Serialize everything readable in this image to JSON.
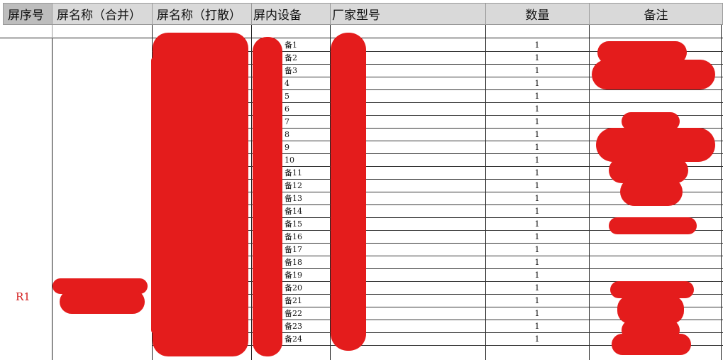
{
  "headers": {
    "screen_no": "屏序号",
    "screen_name_merged": "屏名称（合并）",
    "screen_name_split": "屏名称（打散）",
    "device_in_screen": "屏内设备",
    "vendor_model": "厂家型号",
    "quantity": "数量",
    "remarks": "备注"
  },
  "group": {
    "screen_no": "R1"
  },
  "rows": [
    {
      "device": "备1",
      "qty": "1"
    },
    {
      "device": "备2",
      "qty": "1"
    },
    {
      "device": "备3",
      "qty": "1"
    },
    {
      "device": "4",
      "qty": "1"
    },
    {
      "device": "5",
      "qty": "1"
    },
    {
      "device": "6",
      "qty": "1"
    },
    {
      "device": "7",
      "qty": "1"
    },
    {
      "device": "8",
      "qty": "1"
    },
    {
      "device": "9",
      "qty": "1"
    },
    {
      "device": "10",
      "qty": "1"
    },
    {
      "device": "备11",
      "qty": "1"
    },
    {
      "device": "备12",
      "qty": "1"
    },
    {
      "device": "备13",
      "qty": "1"
    },
    {
      "device": "备14",
      "qty": "1"
    },
    {
      "device": "备15",
      "qty": "1"
    },
    {
      "device": "备16",
      "qty": "1"
    },
    {
      "device": "备17",
      "qty": "1"
    },
    {
      "device": "备18",
      "qty": "1"
    },
    {
      "device": "备19",
      "qty": "1"
    },
    {
      "device": "备20",
      "qty": "1"
    },
    {
      "device": "备21",
      "qty": "1"
    },
    {
      "device": "备22",
      "qty": "1"
    },
    {
      "device": "备23",
      "qty": "1"
    },
    {
      "device": "备24",
      "qty": "1"
    }
  ],
  "colors": {
    "redaction": "#e41c1c",
    "header_bg": "#d9d9d9",
    "r1_text": "#d42020"
  }
}
